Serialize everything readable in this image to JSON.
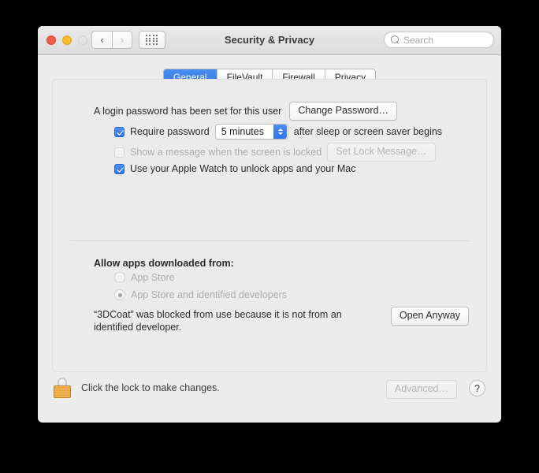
{
  "window": {
    "title": "Security & Privacy",
    "traffic": {
      "close": "close-button",
      "minimize": "minimize-button",
      "zoom": "zoom-button"
    },
    "nav": {
      "back": "‹",
      "forward": "›"
    },
    "search": {
      "placeholder": "Search",
      "value": ""
    }
  },
  "tabs": [
    {
      "label": "General",
      "active": true
    },
    {
      "label": "FileVault",
      "active": false
    },
    {
      "label": "Firewall",
      "active": false
    },
    {
      "label": "Privacy",
      "active": false
    }
  ],
  "general": {
    "login_password_text": "A login password has been set for this user",
    "change_password_button": "Change Password…",
    "require_password": {
      "label": "Require password",
      "checked": true,
      "delay_value": "5 minutes",
      "suffix": "after sleep or screen saver begins"
    },
    "lock_message": {
      "label": "Show a message when the screen is locked",
      "checked": false,
      "enabled": false,
      "button": "Set Lock Message…"
    },
    "apple_watch": {
      "label": "Use your Apple Watch to unlock apps and your Mac",
      "checked": true
    }
  },
  "gatekeeper": {
    "heading": "Allow apps downloaded from:",
    "options": [
      {
        "label": "App Store",
        "selected": false
      },
      {
        "label": "App Store and identified developers",
        "selected": true
      }
    ],
    "blocked_message_line1": "“3DCoat” was blocked from use because it is not from an",
    "blocked_message_line2": "identified developer.",
    "open_anyway_button": "Open Anyway"
  },
  "footer": {
    "lock_text": "Click the lock to make changes.",
    "advanced_button": "Advanced…",
    "help_button": "?"
  },
  "colors": {
    "accent_blue": "#2f74e8",
    "window_bg": "#ececec",
    "panel_bg": "#ebebeb",
    "lock_gold": "#e5a441"
  }
}
